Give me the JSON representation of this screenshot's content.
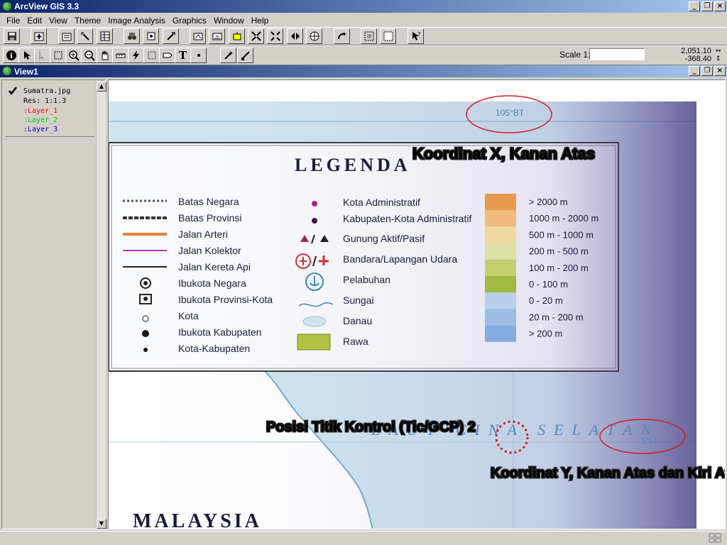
{
  "app": {
    "title": "ArcView GIS 3.3"
  },
  "menu": {
    "items": [
      "File",
      "Edit",
      "View",
      "Theme",
      "Image Analysis",
      "Graphics",
      "Window",
      "Help"
    ]
  },
  "status": {
    "scale_label": "Scale 1:",
    "scale_value": "",
    "coord_x": "2,051.10",
    "coord_y": "-368.40"
  },
  "view": {
    "title": "View1"
  },
  "toc": {
    "theme_name": "Sumatra.jpg",
    "res": "Res: 1:1.3",
    "layers": [
      {
        "name": ":Layer_1",
        "color": "#ff0000"
      },
      {
        "name": ":Layer_2",
        "color": "#00cc00"
      },
      {
        "name": ":Layer_3",
        "color": "#0000cc"
      }
    ]
  },
  "map": {
    "legend_title": "LEGENDA",
    "legend_col1": [
      "Batas Negara",
      "Batas Provinsi",
      "Jalan Arteri",
      "Jalan Kolektor",
      "Jalan Kereta Api",
      "Ibukota Negara",
      "Ibukota Provinsi-Kota",
      "Kota",
      "Ibukota Kabupaten",
      "Kota-Kabupaten"
    ],
    "legend_col2": [
      "Kota Administratif",
      "Kabupaten-Kota Administratif",
      "Gunung Aktif/Pasif",
      "Bandara/Lapangan Udara",
      "Pelabuhan",
      "Sungai",
      "Danau",
      "Rawa"
    ],
    "elevation_classes": [
      {
        "label": "> 2000 m",
        "color": "#e89a4c"
      },
      {
        "label": "1000 m - 2000 m",
        "color": "#efbc7d"
      },
      {
        "label": "500 m - 1000 m",
        "color": "#efd9a0"
      },
      {
        "label": "200 m - 500 m",
        "color": "#dfe0a8"
      },
      {
        "label": "100 m - 200 m",
        "color": "#c7ce6e"
      },
      {
        "label": "0 - 100 m",
        "color": "#9fba3e"
      },
      {
        "label": "0 - 20 m",
        "color": "#b8d0ec"
      },
      {
        "label": "20 m - 200 m",
        "color": "#9dbde6"
      },
      {
        "label": "> 200 m",
        "color": "#84ace0"
      }
    ],
    "label_105": "105°BT",
    "label_5lu": "5°LU",
    "sea_label": "LAUT CINA SELATAN",
    "country_label": "MALAYSIA",
    "ann_x": "Koordinat X, Kanan Atas",
    "ann_tic": "Posisi Titik Kontrol (Tic/GCP) 2",
    "ann_y": "Koordinat Y, Kanan Atas dan Kiri Atas"
  }
}
